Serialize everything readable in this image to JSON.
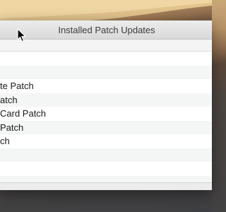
{
  "window": {
    "title": "Installed Patch Updates"
  },
  "list": {
    "rows": [
      "",
      "",
      "te Patch",
      "atch",
      "Card Patch",
      "Patch",
      "ch",
      "",
      "",
      "",
      ""
    ]
  },
  "icons": {
    "cursor": "mouse-pointer-icon"
  }
}
